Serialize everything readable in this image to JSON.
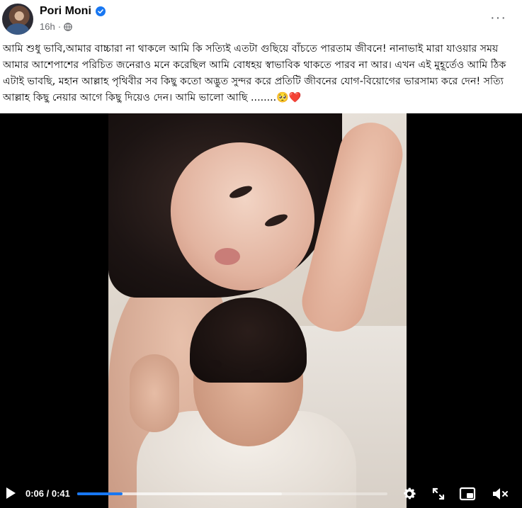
{
  "author": {
    "name": "Pori Moni",
    "verified": true
  },
  "post_meta": {
    "time": "16h",
    "separator": "·",
    "audience_icon": "globe-icon"
  },
  "more_label": "···",
  "post_text": "আমি শুধু ভাবি,আমার বাচ্চারা না থাকলে আমি কি সত্যিই এতটা গুছিয়ে বাঁচতে পারতাম জীবনে! নানাভাই মারা যাওয়ার সময় আমার আশেপাশের পরিচিত জনেরাও মনে করেছিল আমি বোধহয় স্বাভাবিক থাকতে পারব না আর। এখন এই মুহূর্তেও আমি ঠিক এটাই ভাবছি, মহান আল্লাহ পৃথিবীর সব কিছু কতো অদ্ভুত সুন্দর করে প্রতিটি জীবনের যোগ-বিয়োগের ভারসাম্য করে দেন! সত্যি আল্লাহ কিছু নেয়ার আগে কিছু দিয়েও দেন। আমি ভালো আছি ........🥺❤️",
  "video": {
    "current_time": "0:06",
    "duration": "0:41",
    "time_display": "0:06 / 0:41",
    "progress": 0.146,
    "buffered": 0.66
  },
  "colors": {
    "accent": "#1877f2",
    "secondary_text": "#65676b"
  }
}
